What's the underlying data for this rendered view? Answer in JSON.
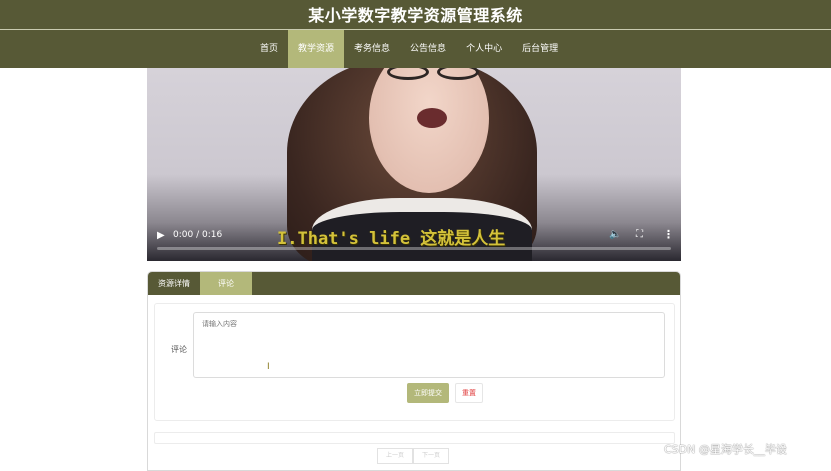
{
  "header": {
    "title": "某小学数字教学资源管理系统",
    "nav": [
      {
        "label": "首页"
      },
      {
        "label": "教学资源"
      },
      {
        "label": "考务信息"
      },
      {
        "label": "公告信息"
      },
      {
        "label": "个人中心"
      },
      {
        "label": "后台管理"
      }
    ],
    "active_nav": "教学资源"
  },
  "video": {
    "time": "0:00 / 0:16",
    "subtitle": "I.That's life 这就是人生",
    "progress": 0.0
  },
  "tabs": [
    {
      "label": "资源详情"
    },
    {
      "label": "评论"
    }
  ],
  "active_tab": "评论",
  "comment": {
    "label": "评论",
    "placeholder": "请输入内容",
    "submit_label": "立即提交",
    "reset_label": "重置"
  },
  "pager": {
    "prev_label": "上一页",
    "next_label": "下一页"
  },
  "watermark": "CSDN @星海学长__毕设",
  "colors": {
    "header_bg": "#575936",
    "accent": "#b3b87a",
    "reset_text": "#e03c3c"
  },
  "icons": [
    "play-icon",
    "volume-icon",
    "fullscreen-icon",
    "more-options-icon"
  ]
}
